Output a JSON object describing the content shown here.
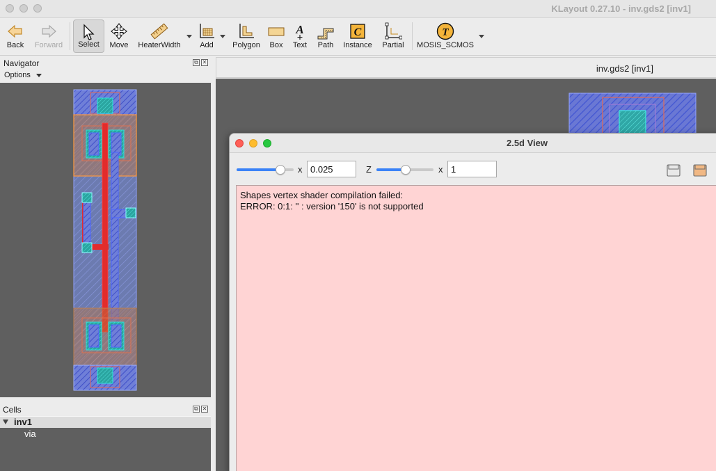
{
  "window": {
    "title": "KLayout 0.27.10 - inv.gds2 [inv1]"
  },
  "toolbar": {
    "back": "Back",
    "forward": "Forward",
    "select": "Select",
    "move": "Move",
    "heater_width": "HeaterWidth",
    "add": "Add",
    "polygon": "Polygon",
    "box": "Box",
    "text": "Text",
    "path": "Path",
    "instance": "Instance",
    "partial": "Partial",
    "tech": "MOSIS_SCMOS",
    "icons": {
      "back": "arrow-left-icon",
      "forward": "arrow-right-icon",
      "select": "cursor-icon",
      "move": "move-arrows-icon",
      "heater_width": "ruler-icon",
      "add": "add-grid-icon",
      "polygon": "polygon-icon",
      "box": "box-icon",
      "text": "text-A-icon",
      "path": "path-icon",
      "instance": "instance-C-icon",
      "partial": "partial-edit-icon",
      "tech": "tech-T-icon"
    }
  },
  "navigator": {
    "title": "Navigator",
    "options": "Options"
  },
  "cells": {
    "title": "Cells",
    "items": [
      {
        "name": "inv1",
        "level": 0,
        "expanded": true
      },
      {
        "name": "via",
        "level": 1
      }
    ]
  },
  "main": {
    "tab_title": "inv.gds2 [inv1]"
  },
  "dialog": {
    "title": "2.5d View",
    "scale_x_label": "x",
    "scale_x_value": "0.025",
    "z_label": "Z",
    "scale_z_label": "x",
    "scale_z_value": "1",
    "error_line1": "Shapes vertex shader compilation failed:",
    "error_line2": "ERROR: 0:1: '' :  version '150' is not supported"
  },
  "colors": {
    "canvas": "#5f5f5f",
    "error_bg": "#ffd4d4",
    "metal_blue": "#5a6ee6",
    "poly_red": "#ee2222",
    "orange": "#e07a2c",
    "via_cyan": "#22d0d0"
  }
}
